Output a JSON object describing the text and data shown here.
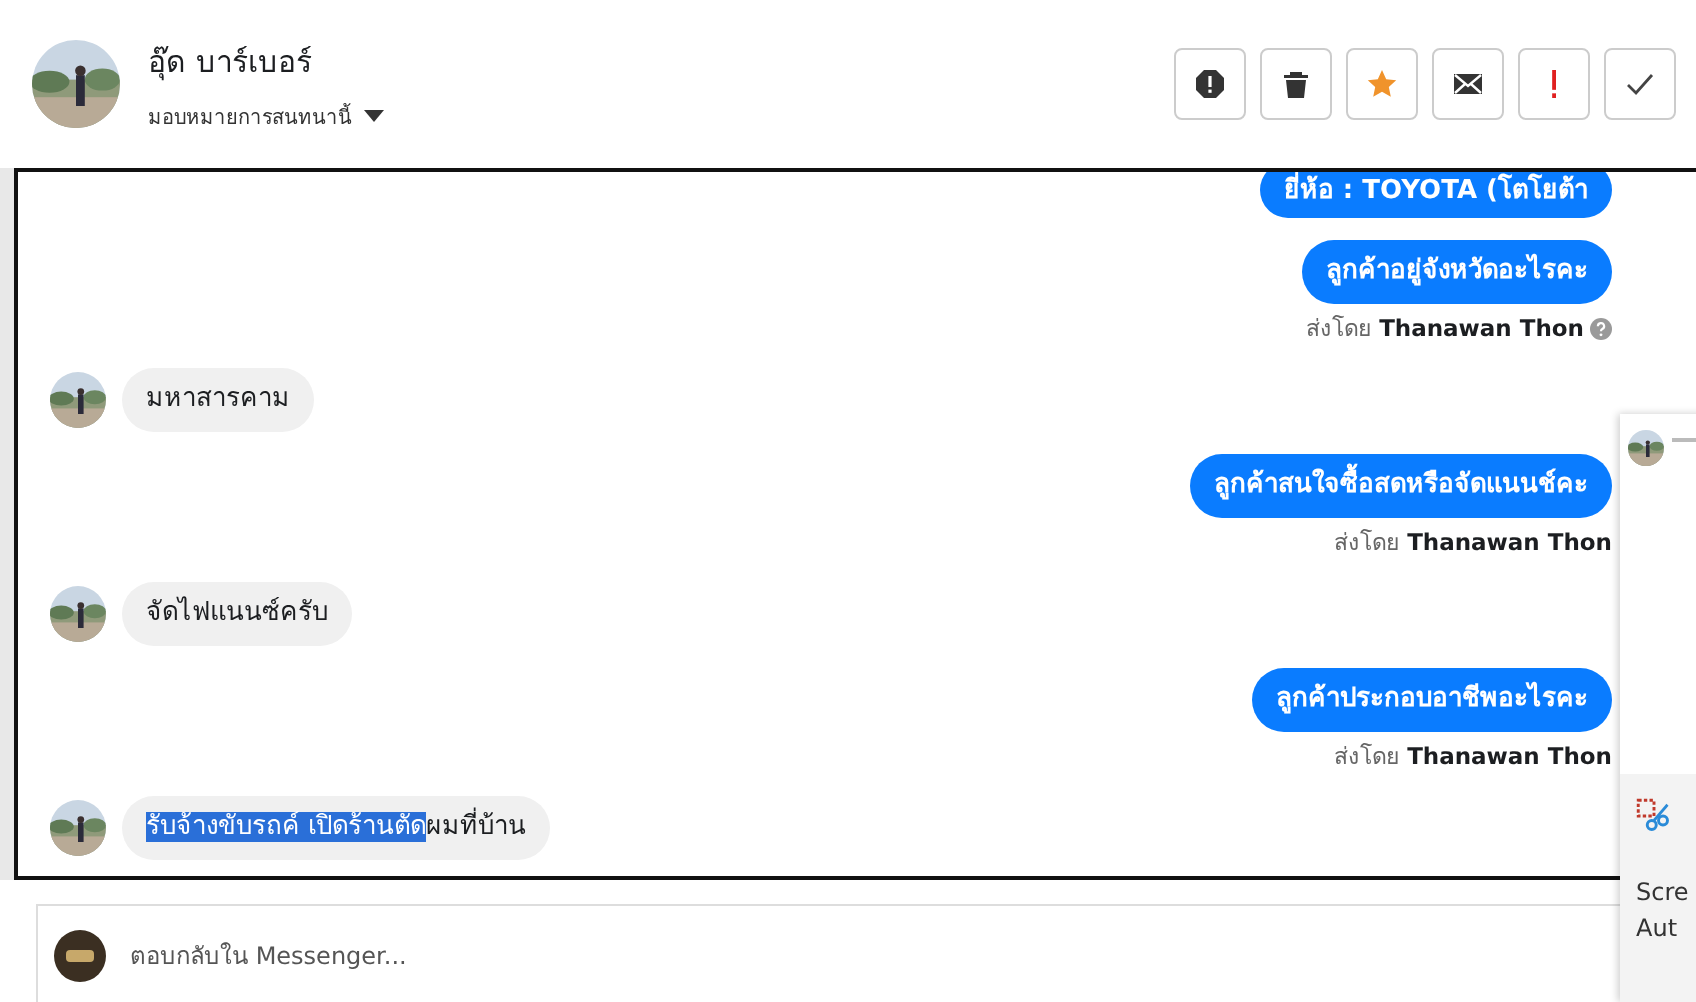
{
  "header": {
    "name": "อุ๊ด บาร์เบอร์",
    "assign_label": "มอบหมายการสนทนานี้",
    "actions": [
      {
        "kind": "spam"
      },
      {
        "kind": "delete"
      },
      {
        "kind": "star"
      },
      {
        "kind": "mail"
      },
      {
        "kind": "important"
      },
      {
        "kind": "done"
      }
    ]
  },
  "messages": [
    {
      "kind": "out",
      "text": "ยี่ห้อ : TOYOTA (โตโยต้า"
    },
    {
      "kind": "out",
      "text": "ลูกค้าอยู่จังหวัดอะไรคะ",
      "sender_prefix": "ส่งโดย",
      "sender": "Thanawan Thon",
      "help": true
    },
    {
      "kind": "in",
      "text": "มหาสารคาม"
    },
    {
      "kind": "out",
      "text": "ลูกค้าสนใจซื้อสดหรือจัดแนนช์คะ",
      "sender_prefix": "ส่งโดย",
      "sender": "Thanawan Thon",
      "help": false
    },
    {
      "kind": "in",
      "text": "จัดไฟแนนซ์ครับ"
    },
    {
      "kind": "out",
      "text": "ลูกค้าประกอบอาชีพอะไรคะ",
      "sender_prefix": "ส่งโดย",
      "sender": "Thanawan Thon",
      "help": false
    },
    {
      "kind": "in",
      "selected_part": "รับจ้างขับรถค์ เปิดร้านตัด",
      "text": "ผมที่บ้าน"
    }
  ],
  "reply": {
    "placeholder": "ตอบกลับใน Messenger..."
  },
  "notification": {
    "lines": [
      "Scre",
      "Aut"
    ]
  }
}
